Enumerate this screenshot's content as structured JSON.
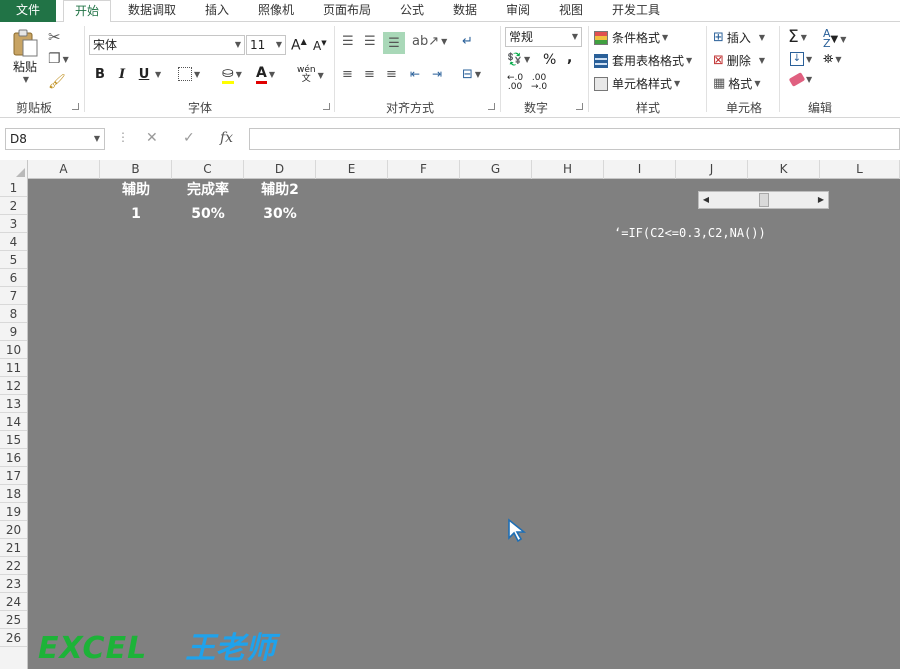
{
  "tabs": [
    {
      "label": "文件"
    },
    {
      "label": "开始"
    },
    {
      "label": "数据调取"
    },
    {
      "label": "插入"
    },
    {
      "label": "照像机"
    },
    {
      "label": "页面布局"
    },
    {
      "label": "公式"
    },
    {
      "label": "数据"
    },
    {
      "label": "审阅"
    },
    {
      "label": "视图"
    },
    {
      "label": "开发工具"
    }
  ],
  "ribbon": {
    "clipboard": {
      "paste_label": "粘贴",
      "group_label": "剪贴板"
    },
    "font": {
      "font_name": "宋体",
      "font_size": "11",
      "group_label": "字体",
      "bold": "B",
      "italic": "I",
      "underline": "U",
      "phonetic": "wén"
    },
    "alignment": {
      "group_label": "对齐方式"
    },
    "number": {
      "format": "常规",
      "percent": "%",
      "comma": ",",
      "group_label": "数字"
    },
    "styles": {
      "conditional": "条件格式",
      "table": "套用表格格式",
      "cell": "单元格样式",
      "group_label": "样式"
    },
    "cells": {
      "insert": "插入",
      "delete": "删除",
      "format": "格式",
      "group_label": "单元格"
    },
    "editing": {
      "group_label": "编辑"
    }
  },
  "formula_bar": {
    "name_box": "D8",
    "fx": "fx",
    "formula": ""
  },
  "columns": [
    "A",
    "B",
    "C",
    "D",
    "E",
    "F",
    "G",
    "H",
    "I",
    "J",
    "K",
    "L"
  ],
  "rows": [
    "1",
    "2",
    "3",
    "4",
    "5",
    "6",
    "7",
    "8",
    "9",
    "10",
    "11",
    "12",
    "13",
    "14",
    "15",
    "16",
    "17",
    "18",
    "19",
    "20",
    "21",
    "22",
    "23",
    "24",
    "25",
    "26"
  ],
  "cells": {
    "B1": "辅助",
    "C1": "完成率",
    "D1": "辅助2",
    "B2": "1",
    "C2": "50%",
    "D2": "30%"
  },
  "formula_note": "‘=IF(C2<=0.3,C2,NA())",
  "scrollbar": {
    "value_fraction": 0.5
  },
  "watermark": {
    "excel": "EXCEL",
    "name": "王老师"
  },
  "colors": {
    "sheet_bg": "#808080",
    "accent": "#217346",
    "watermark_green": "#1db338",
    "watermark_blue": "#1fa2ec"
  }
}
